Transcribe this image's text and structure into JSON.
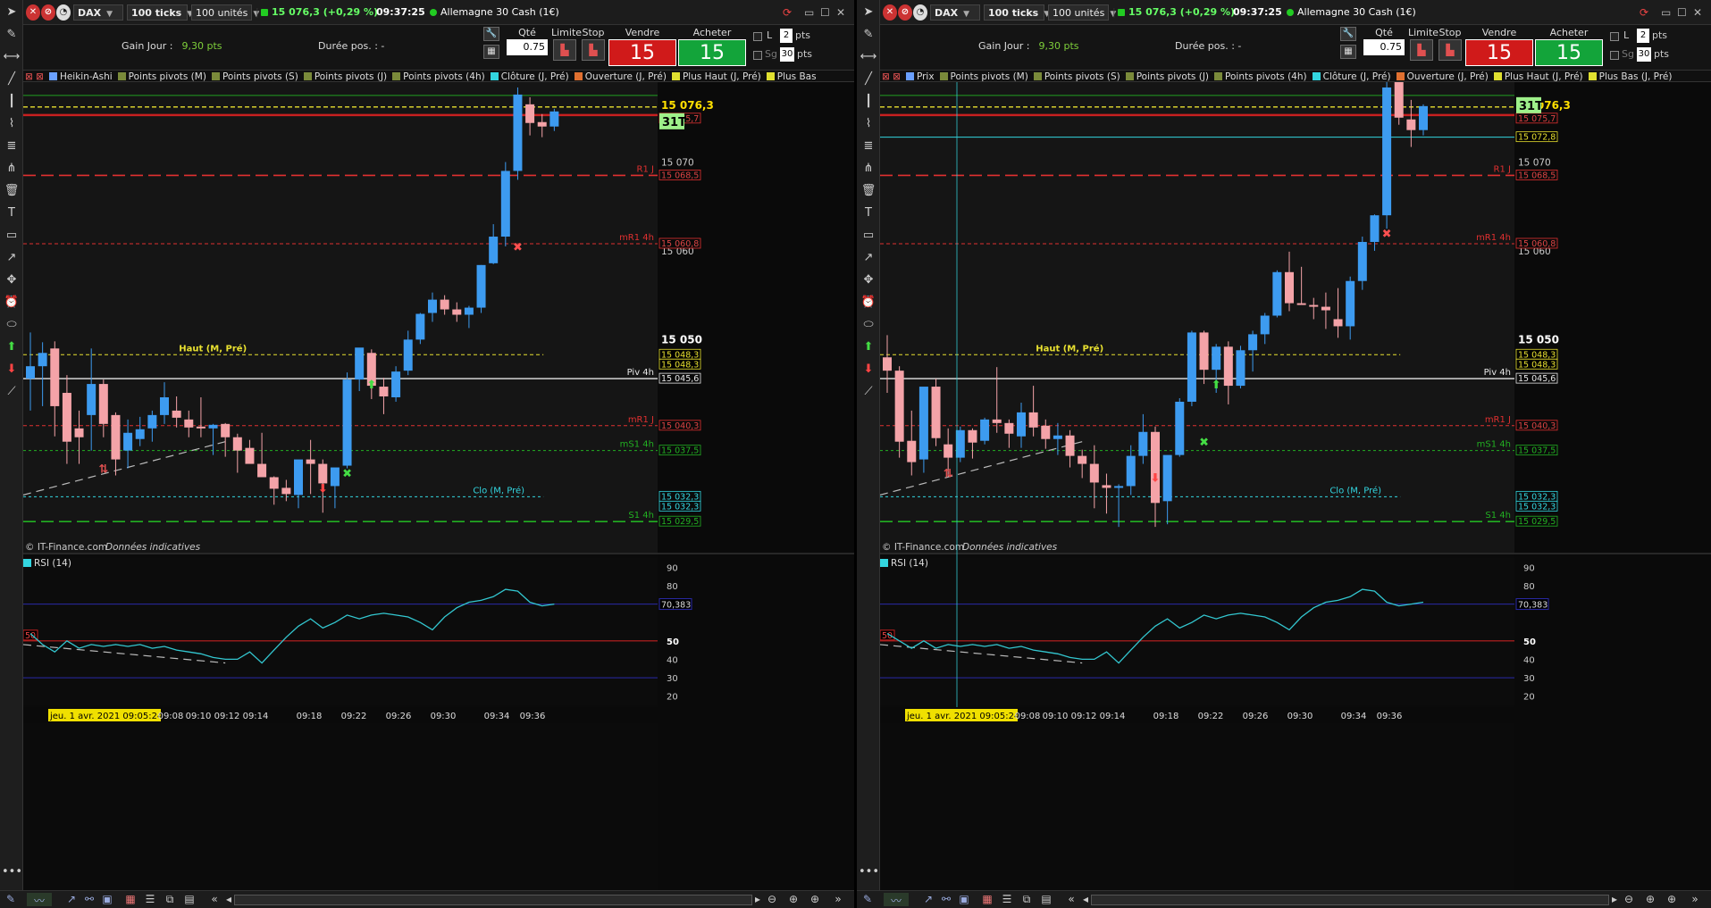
{
  "instrument": {
    "symbol": "DAX",
    "interval": "100 ticks",
    "units": "100 unités",
    "last": "15 076,3 (+0,29 %)",
    "time": "09:37:25",
    "name": "Allemagne 30 Cash (1€)"
  },
  "info": {
    "gain_label": "Gain Jour :",
    "gain_value": "9,30 pts",
    "duration_label": "Durée pos. :",
    "duration_value": "-"
  },
  "order": {
    "qty_label": "Qté",
    "qty_value": "0.75",
    "limit_label": "Limite",
    "stop_label": "Stop",
    "sell_label": "Vendre",
    "buy_label": "Acheter",
    "sell_price": "15 075,7",
    "buy_price": "15 076,9",
    "l_label": "L",
    "sg_label": "Sg",
    "pts_value_1": "2",
    "pts_value_2": "30",
    "pts_label": "pts"
  },
  "panels": [
    {
      "indicators": [
        {
          "label": "Heikin-Ashi",
          "color": "#6aa0ff"
        },
        {
          "label": "Points pivots (M)",
          "color": "#7a8a3a"
        },
        {
          "label": "Points pivots (S)",
          "color": "#7a8a3a"
        },
        {
          "label": "Points pivots (J)",
          "color": "#7a8a3a"
        },
        {
          "label": "Points pivots (4h)",
          "color": "#7a8a3a"
        },
        {
          "label": "Clôture (J, Pré)",
          "color": "#33d6e0"
        },
        {
          "label": "Ouverture (J, Pré)",
          "color": "#e07030"
        },
        {
          "label": "Plus Haut (J, Pré)",
          "color": "#e0e030"
        },
        {
          "label": "Plus Bas",
          "color": "#e0e030"
        }
      ],
      "badge": "31T",
      "right_tags": [
        {
          "text": "15 076,3",
          "style": "last"
        },
        {
          "text": "15 075,7",
          "style": "red"
        },
        {
          "text": "15 068,5",
          "style": "red"
        },
        {
          "text": "15 060,8",
          "style": "red"
        },
        {
          "text": "15 048,3",
          "style": "yellow"
        },
        {
          "text": "15 048,3",
          "style": "yellow"
        },
        {
          "text": "15 045,6",
          "style": "white"
        },
        {
          "text": "15 040,3",
          "style": "red"
        },
        {
          "text": "15 037,5",
          "style": "green"
        },
        {
          "text": "15 032,3",
          "style": "cyan"
        },
        {
          "text": "15 032,3",
          "style": "cyan"
        },
        {
          "text": "15 029,5",
          "style": "green"
        }
      ],
      "levels": [
        {
          "label": "R1 J",
          "style": "red"
        },
        {
          "label": "mR1 4h",
          "style": "red"
        },
        {
          "label": "Haut (M, Pré)",
          "style": "yellow"
        },
        {
          "label": "Piv 4h",
          "style": "white"
        },
        {
          "label": "mR1 J",
          "style": "red"
        },
        {
          "label": "mS1 4h",
          "style": "green"
        },
        {
          "label": "Clo (M, Pré)",
          "style": "cyan"
        },
        {
          "label": "S1 4h",
          "style": "green"
        }
      ],
      "time_labels": [
        "09:08",
        "09:10",
        "09:12",
        "09:14",
        "09:18",
        "09:22",
        "09:26",
        "09:30",
        "09:34",
        "09:36"
      ]
    },
    {
      "indicators": [
        {
          "label": "Prix",
          "color": "#6aa0ff"
        },
        {
          "label": "Points pivots (M)",
          "color": "#7a8a3a"
        },
        {
          "label": "Points pivots (S)",
          "color": "#7a8a3a"
        },
        {
          "label": "Points pivots (J)",
          "color": "#7a8a3a"
        },
        {
          "label": "Points pivots (4h)",
          "color": "#7a8a3a"
        },
        {
          "label": "Clôture (J, Pré)",
          "color": "#33d6e0"
        },
        {
          "label": "Ouverture (J, Pré)",
          "color": "#e07030"
        },
        {
          "label": "Plus Haut (J, Pré)",
          "color": "#e0e030"
        },
        {
          "label": "Plus Bas (J, Pré)",
          "color": "#e0e030"
        }
      ],
      "badge": "31T",
      "right_tags": [
        {
          "text": "15 076,3",
          "style": "last"
        },
        {
          "text": "15 075,7",
          "style": "red"
        },
        {
          "text": "15 072,8",
          "style": "yellow"
        },
        {
          "text": "15 068,5",
          "style": "red"
        },
        {
          "text": "15 060,8",
          "style": "red"
        },
        {
          "text": "15 048,3",
          "style": "yellow"
        },
        {
          "text": "15 048,3",
          "style": "yellow"
        },
        {
          "text": "15 045,6",
          "style": "white"
        },
        {
          "text": "15 040,3",
          "style": "red"
        },
        {
          "text": "15 037,5",
          "style": "green"
        },
        {
          "text": "15 032,3",
          "style": "cyan"
        },
        {
          "text": "15 032,3",
          "style": "cyan"
        },
        {
          "text": "15 029,5",
          "style": "green"
        }
      ],
      "levels": [
        {
          "label": "R1 J",
          "style": "red"
        },
        {
          "label": "mR1 4h",
          "style": "red"
        },
        {
          "label": "Haut (M, Pré)",
          "style": "yellow"
        },
        {
          "label": "Piv 4h",
          "style": "white"
        },
        {
          "label": "mR1 J",
          "style": "red"
        },
        {
          "label": "mS1 4h",
          "style": "green"
        },
        {
          "label": "Clo (M, Pré)",
          "style": "cyan"
        },
        {
          "label": "S1 4h",
          "style": "green"
        }
      ],
      "time_labels": [
        "09:08",
        "09:10",
        "09:12",
        "09:14",
        "09:18",
        "09:22",
        "09:26",
        "09:30",
        "09:34",
        "09:36"
      ]
    }
  ],
  "price_axis_ticks": [
    "15 070",
    "15 060",
    "15 050"
  ],
  "rsi": {
    "label": "RSI (14)",
    "value_tag": "70,383",
    "mid_tag": "50",
    "ticks": [
      "90",
      "80",
      "70",
      "50",
      "40",
      "30",
      "20"
    ]
  },
  "footer": {
    "source": "© IT-Finance.com",
    "note": "Données indicatives",
    "cursor_date": "jeu. 1 avr. 2021 09:05:24"
  },
  "colors": {
    "bull": "#3d9bf0",
    "bear": "#f4a3a8",
    "red_level": "#e03030",
    "green_level": "#22b022",
    "yellow_level": "#e8e030",
    "cyan_level": "#33d6e0",
    "rsi_line": "#33c7d0",
    "up_arrow": "#44dd44",
    "down_arrow": "#ff4444"
  },
  "chart_data": [
    {
      "type": "candlestick",
      "title": "",
      "ylim": [
        15026,
        15079
      ],
      "candles": [
        [
          15045.6,
          15050.8,
          15042.0,
          15047.0
        ],
        [
          15047.0,
          15049.7,
          15042.5,
          15048.5
        ],
        [
          15049.0,
          15049.8,
          15039.1,
          15042.5
        ],
        [
          15044.0,
          15046.0,
          15036.0,
          15038.5
        ],
        [
          15040.0,
          15042.0,
          15036.0,
          15039.0
        ],
        [
          15041.5,
          15049.0,
          15037.5,
          15045.0
        ],
        [
          15045.0,
          15045.5,
          15039.0,
          15040.5
        ],
        [
          15041.5,
          15041.8,
          15034.7,
          15036.5
        ],
        [
          15037.5,
          15041.0,
          15035.5,
          15039.5
        ],
        [
          15038.8,
          15041.3,
          15038.0,
          15039.9
        ],
        [
          15040.0,
          15042.0,
          15038.5,
          15041.5
        ],
        [
          15041.5,
          15045.2,
          15040.5,
          15043.5
        ],
        [
          15042.0,
          15043.6,
          15040.1,
          15041.2
        ],
        [
          15041.0,
          15042.0,
          15039.0,
          15040.1
        ],
        [
          15040.2,
          15043.5,
          15039.0,
          15040.0
        ],
        [
          15040.0,
          15040.5,
          15037.0,
          15040.4
        ],
        [
          15040.5,
          15040.6,
          15036.8,
          15039.0
        ],
        [
          15039.0,
          15039.4,
          15035.0,
          15037.5
        ],
        [
          15037.8,
          15038.7,
          15036.4,
          15036.0
        ],
        [
          15036.0,
          15039.5,
          15035.0,
          15034.5
        ],
        [
          15034.5,
          15034.6,
          15031.4,
          15033.2
        ],
        [
          15033.3,
          15034.2,
          15031.8,
          15032.6
        ],
        [
          15032.5,
          15035.0,
          15031.0,
          15036.5
        ],
        [
          15036.5,
          15038.7,
          15032.6,
          15036.0
        ],
        [
          15036.0,
          15036.5,
          15030.5,
          15033.8
        ],
        [
          15033.5,
          15034.0,
          15031.0,
          15035.6
        ],
        [
          15035.8,
          15046.3,
          15035.5,
          15045.5
        ],
        [
          15045.5,
          15049.0,
          15044.2,
          15049.1
        ],
        [
          15048.5,
          15048.9,
          15043.3,
          15044.8
        ],
        [
          15044.7,
          15045.7,
          15041.6,
          15043.6
        ],
        [
          15043.5,
          15047.0,
          15043.0,
          15046.4
        ],
        [
          15046.5,
          15051.0,
          15046.0,
          15050.0
        ],
        [
          15050.0,
          15053.0,
          15049.5,
          15052.9
        ],
        [
          15053.0,
          15055.3,
          15052.0,
          15054.5
        ],
        [
          15054.5,
          15055.0,
          15052.8,
          15053.4
        ],
        [
          15053.4,
          15054.2,
          15052.0,
          15052.8
        ],
        [
          15052.8,
          15053.8,
          15051.3,
          15053.6
        ],
        [
          15053.6,
          15058.4,
          15053.0,
          15058.4
        ],
        [
          15058.6,
          15063.0,
          15058.5,
          15061.6
        ],
        [
          15061.6,
          15070.0,
          15060.5,
          15069.0
        ],
        [
          15069.0,
          15078.4,
          15068.0,
          15077.6
        ],
        [
          15076.5,
          15077.3,
          15073.0,
          15074.4
        ],
        [
          15074.5,
          15075.4,
          15072.8,
          15074.0
        ],
        [
          15074.0,
          15076.0,
          15073.5,
          15075.7
        ]
      ],
      "levels": [
        15075.7,
        15068.5,
        15060.8,
        15048.3,
        15045.6,
        15040.3,
        15037.5,
        15032.3,
        15029.5
      ],
      "rsi": [
        54,
        48,
        44,
        50,
        46,
        48,
        47,
        48,
        47,
        48,
        46,
        47,
        45,
        44,
        43,
        41,
        40,
        40,
        44,
        38,
        45,
        52,
        58,
        62,
        57,
        60,
        64,
        62,
        64,
        65,
        64,
        63,
        60,
        56,
        63,
        68,
        71,
        72,
        74,
        78,
        77,
        71,
        69,
        70
      ],
      "rsi_ylim": [
        15,
        95
      ]
    },
    {
      "type": "candlestick",
      "title": "",
      "ylim": [
        15026,
        15079
      ],
      "candles": [
        [
          15048.0,
          15050.5,
          15044.0,
          15046.5
        ],
        [
          15046.5,
          15047.0,
          15036.7,
          15038.5
        ],
        [
          15038.6,
          15042.0,
          15034.7,
          15036.2
        ],
        [
          15036.5,
          15043.5,
          15035.0,
          15044.7
        ],
        [
          15044.7,
          15045.6,
          15038.0,
          15038.9
        ],
        [
          15038.2,
          15040.0,
          15034.6,
          15036.7
        ],
        [
          15036.7,
          15040.2,
          15036.2,
          15039.8
        ],
        [
          15039.8,
          15040.0,
          15036.6,
          15038.4
        ],
        [
          15038.6,
          15041.2,
          15038.2,
          15041.0
        ],
        [
          15041.0,
          15046.9,
          15039.5,
          15040.6
        ],
        [
          15040.6,
          15041.0,
          15037.8,
          15039.4
        ],
        [
          15039.1,
          15042.9,
          15037.8,
          15041.8
        ],
        [
          15041.8,
          15044.8,
          15039.1,
          15040.1
        ],
        [
          15040.3,
          15041.0,
          15037.7,
          15038.8
        ],
        [
          15038.8,
          15040.6,
          15037.0,
          15039.2
        ],
        [
          15039.2,
          15039.8,
          15035.6,
          15036.9
        ],
        [
          15036.9,
          15037.6,
          15034.4,
          15036.0
        ],
        [
          15036.0,
          15038.1,
          15031.0,
          15033.9
        ],
        [
          15033.6,
          15034.9,
          15030.4,
          15033.3
        ],
        [
          15033.3,
          15033.7,
          15028.9,
          15033.5
        ],
        [
          15033.5,
          15038.1,
          15032.5,
          15036.9
        ],
        [
          15036.9,
          15041.6,
          15036.0,
          15039.6
        ],
        [
          15039.6,
          15040.2,
          15028.9,
          15031.6
        ],
        [
          15031.8,
          15036.5,
          15029.2,
          15037.0
        ],
        [
          15037.0,
          15043.4,
          15036.8,
          15043.0
        ],
        [
          15043.0,
          15051.0,
          15042.5,
          15050.8
        ],
        [
          15050.8,
          15051.0,
          15045.0,
          15046.6
        ],
        [
          15046.6,
          15049.5,
          15044.0,
          15049.2
        ],
        [
          15049.2,
          15049.8,
          15042.7,
          15044.8
        ],
        [
          15044.8,
          15049.3,
          15044.5,
          15048.8
        ],
        [
          15048.8,
          15051.0,
          15046.4,
          15050.6
        ],
        [
          15050.6,
          15053.0,
          15049.5,
          15052.7
        ],
        [
          15052.7,
          15057.8,
          15052.5,
          15057.6
        ],
        [
          15057.6,
          15059.9,
          15053.2,
          15054.1
        ],
        [
          15054.1,
          15058.2,
          15054.0,
          15053.9
        ],
        [
          15053.9,
          15054.7,
          15052.3,
          15053.7
        ],
        [
          15053.7,
          15055.3,
          15051.2,
          15053.3
        ],
        [
          15052.3,
          15055.8,
          15050.2,
          15051.5
        ],
        [
          15051.5,
          15057.1,
          15050.0,
          15056.6
        ],
        [
          15056.6,
          15061.6,
          15055.6,
          15061.0
        ],
        [
          15061.0,
          15064.1,
          15060.0,
          15064.0
        ],
        [
          15064.0,
          15080.0,
          15062.5,
          15078.4
        ],
        [
          15079.0,
          15080.5,
          15074.2,
          15075.0
        ],
        [
          15074.8,
          15077.0,
          15071.7,
          15073.6
        ],
        [
          15073.6,
          15076.5,
          15073.0,
          15076.3
        ]
      ],
      "levels": [
        15075.7,
        15072.8,
        15068.5,
        15060.8,
        15048.3,
        15045.6,
        15040.3,
        15037.5,
        15032.3,
        15029.5
      ],
      "rsi": [
        54,
        50,
        46,
        50,
        46,
        48,
        47,
        48,
        47,
        48,
        46,
        47,
        45,
        44,
        43,
        41,
        40,
        40,
        44,
        38,
        45,
        52,
        58,
        62,
        57,
        60,
        64,
        62,
        64,
        65,
        64,
        63,
        60,
        56,
        63,
        68,
        71,
        72,
        74,
        78,
        77,
        71,
        69,
        70,
        71
      ],
      "rsi_ylim": [
        15,
        95
      ]
    }
  ]
}
